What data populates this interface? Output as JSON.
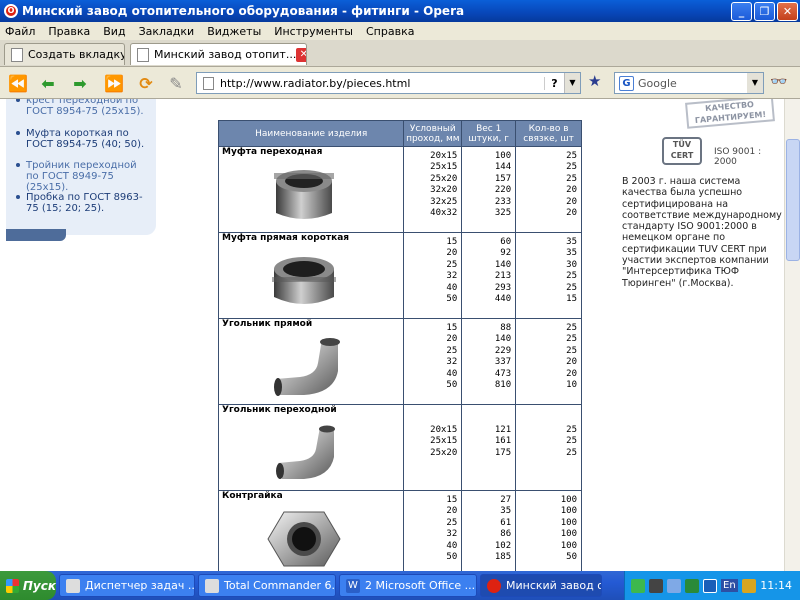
{
  "window": {
    "title": "Минский завод отопительного оборудования - фитинги - Opera",
    "icon": "opera-icon"
  },
  "menu": [
    "Файл",
    "Правка",
    "Вид",
    "Закладки",
    "Виджеты",
    "Инструменты",
    "Справка"
  ],
  "tabs": {
    "new_tab": "Создать вкладку",
    "active_tab": "Минский завод отопит..."
  },
  "address": {
    "url": "http://www.radiator.by/pieces.html"
  },
  "search": {
    "placeholder": "Google"
  },
  "sidebar": {
    "items": [
      "крест переходной по ГОСТ 8954-75 (25х15).",
      "Муфта короткая по ГОСТ 8954-75 (40; 50).",
      "Тройник переходной по ГОСТ 8949-75 (25х15).",
      "Пробка по ГОСТ 8963-75 (15; 20; 25)."
    ]
  },
  "table": {
    "headers": [
      "Наименование изделия",
      "Условный проход, мм",
      "Вес 1 штуки, г",
      "Кол-во в связке, шт"
    ],
    "sections": [
      {
        "name": "Муфта переходная",
        "icon": "coupling-reducing-icon",
        "sizes": "20x15\n25x15\n25x20\n32x20\n32x25\n40x32",
        "weights": "100\n144\n157\n220\n233\n325",
        "counts": "25\n25\n25\n20\n20\n20"
      },
      {
        "name": "Муфта прямая короткая",
        "icon": "coupling-straight-icon",
        "sizes": "15\n20\n25\n32\n40\n50",
        "weights": "60\n92\n140\n213\n293\n440",
        "counts": "35\n35\n30\n25\n25\n15"
      },
      {
        "name": "Угольник прямой",
        "icon": "elbow-icon",
        "sizes": "15\n20\n25\n32\n40\n50",
        "weights": "88\n140\n229\n337\n473\n810",
        "counts": "25\n25\n25\n20\n20\n10"
      },
      {
        "name": "Угольник переходной",
        "icon": "elbow-reducing-icon",
        "sizes": "20x15\n25x15\n25x20",
        "weights": "121\n161\n175",
        "counts": "25\n25\n25"
      },
      {
        "name": "Контргайка",
        "icon": "locknut-icon",
        "sizes": "15\n20\n25\n32\n40\n50",
        "weights": "27\n35\n61\n86\n102\n185",
        "counts": "100\n100\n100\n100\n100\n50"
      }
    ]
  },
  "right": {
    "stamp": "КАЧЕСТВО ГАРАНТИРУЕМ!",
    "logo_text": "TÜV CERT",
    "iso_label": "ISO 9001 : 2000",
    "text": "В 2003 г. наша система качества была успешно сертифицирована на соответствие международному стандарту ISO 9001:2000 в немецком органе по сертификации TUV CERT при участии экспертов компании \"Интерсертифика ТЮФ Тюринген\" (г.Москва)."
  },
  "taskbar": {
    "start": "Пуск",
    "buttons": [
      "Диспетчер задач ...",
      "Total Commander 6....",
      "2 Microsoft Office ...",
      "Минский завод о..."
    ],
    "lang": "En",
    "clock": "11:14"
  }
}
